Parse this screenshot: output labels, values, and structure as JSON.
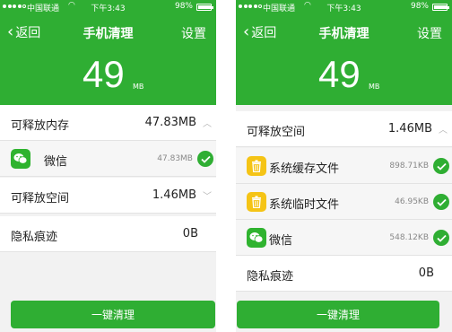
{
  "status": {
    "carrier": "中国联通",
    "time": "下午3:43",
    "battery_pct": "98%",
    "battery_level": 0.98
  },
  "nav": {
    "back": "返回",
    "title": "手机清理",
    "settings": "设置"
  },
  "summary": {
    "value": "49",
    "unit": "MB"
  },
  "left": {
    "memory_label": "可释放内存",
    "memory_value": "47.83MB",
    "wechat_name": "微信",
    "wechat_size": "47.83MB",
    "space_label": "可释放空间",
    "space_value": "1.46MB",
    "privacy_label": "隐私痕迹",
    "privacy_value": "0B",
    "cta": "一键清理"
  },
  "right": {
    "space_label": "可释放空间",
    "space_value": "1.46MB",
    "items": [
      {
        "name": "系统缓存文件",
        "size": "898.71KB",
        "icon": "trash-icon"
      },
      {
        "name": "系统临时文件",
        "size": "46.95KB",
        "icon": "trash-icon"
      },
      {
        "name": "微信",
        "size": "548.12KB",
        "icon": "wechat-icon"
      }
    ],
    "privacy_label": "隐私痕迹",
    "privacy_value": "0B",
    "cta": "一键清理"
  },
  "colors": {
    "brand_green": "#2fae33",
    "trash_yellow": "#f5c416"
  }
}
